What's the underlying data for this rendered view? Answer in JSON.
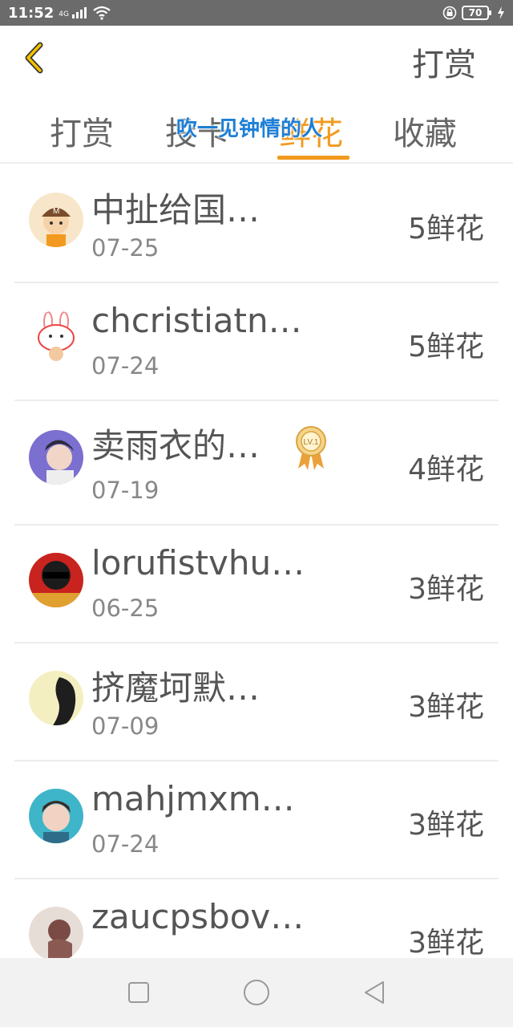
{
  "status_bar": {
    "time": "11:52",
    "network": "4G",
    "battery": "70"
  },
  "header": {
    "back_icon": "chevron-left-icon",
    "action_label": "打赏"
  },
  "tabs": [
    {
      "label": "打赏"
    },
    {
      "label": "投卡"
    },
    {
      "label": "鲜花",
      "active": true
    },
    {
      "label": "收藏"
    }
  ],
  "overlay_text": "吹一见钟情的人",
  "accent_color": "#f29a1f",
  "list": {
    "items": [
      {
        "name": "中扯给国…",
        "date": "07-25",
        "amount": "5鲜花",
        "avatar": "cartoon-boy-avatar"
      },
      {
        "name": "chcristiatn…",
        "date": "07-24",
        "amount": "5鲜花",
        "avatar": "bunny-avatar"
      },
      {
        "name": "卖雨衣的…",
        "date": "07-19",
        "amount": "4鲜花",
        "avatar": "photo-avatar",
        "badge": "LV.1"
      },
      {
        "name": "lorufistvhu…",
        "date": "06-25",
        "amount": "3鲜花",
        "avatar": "sunglasses-avatar"
      },
      {
        "name": "挤魔坷默…",
        "date": "07-09",
        "amount": "3鲜花",
        "avatar": "girl-silhouette-avatar"
      },
      {
        "name": "mahjmxm…",
        "date": "07-24",
        "amount": "3鲜花",
        "avatar": "boy-photo-avatar"
      },
      {
        "name": "zaucpsbov…",
        "date": "",
        "amount": "3鲜花",
        "avatar": "dark-photo-avatar"
      }
    ]
  },
  "nav_bar": {
    "recent_icon": "square-icon",
    "home_icon": "circle-icon",
    "back_icon": "triangle-back-icon"
  }
}
